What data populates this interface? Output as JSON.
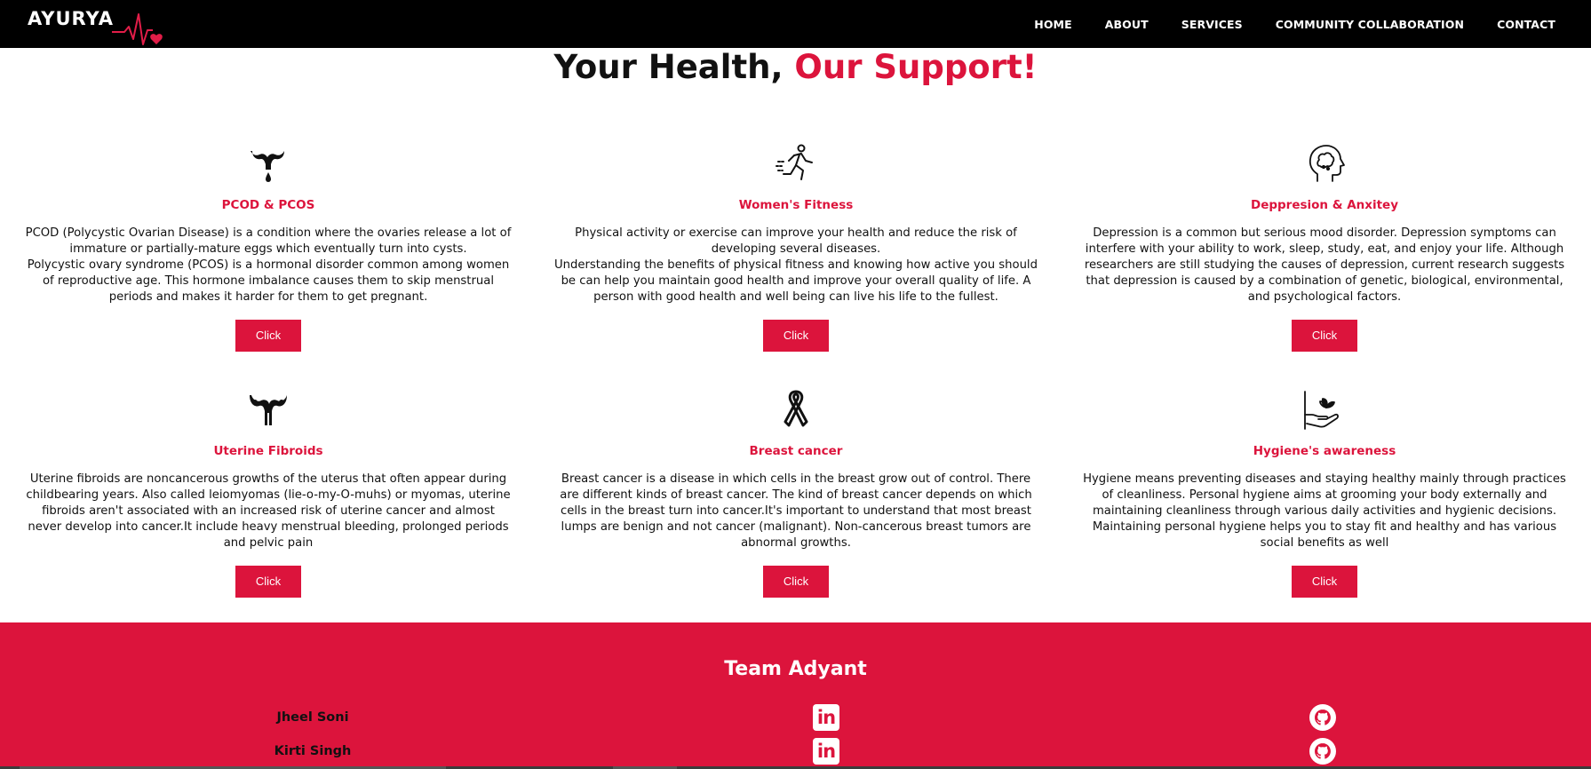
{
  "nav": {
    "brand": "AYURYA",
    "links": [
      "HOME",
      "ABOUT",
      "SERVICES",
      "COMMUNITY COLLABORATION",
      "CONTACT"
    ]
  },
  "hero": {
    "title_part1": "Your Health, ",
    "title_part2": "Our Support!"
  },
  "cards": [
    {
      "icon": "uterus-drop-icon",
      "title": "PCOD & PCOS",
      "desc": [
        "PCOD (Polycystic Ovarian Disease) is a condition where the ovaries release a lot of immature or partially-mature eggs which eventually turn into cysts.",
        "Polycystic ovary syndrome (PCOS) is a hormonal disorder common among women of reproductive age. This hormone imbalance causes them to skip menstrual periods and makes it harder for them to get pregnant."
      ],
      "button": "Click"
    },
    {
      "icon": "running-person-icon",
      "title": "Women's Fitness",
      "desc": [
        "Physical activity or exercise can improve your health and reduce the risk of developing several diseases.",
        "Understanding the benefits of physical fitness and knowing how active you should be can help you maintain good health and improve your overall quality of life. A person with good health and well being can live his life to the fullest."
      ],
      "button": "Click"
    },
    {
      "icon": "head-brain-icon",
      "title": "Deppresion & Anxitey",
      "desc": [
        "Depression is a common but serious mood disorder. Depression symptoms can interfere with your ability to work, sleep, study, eat, and enjoy your life. Although researchers are still studying the causes of depression, current research suggests that depression is caused by a combination of genetic, biological, environmental, and psychological factors."
      ],
      "button": "Click"
    },
    {
      "icon": "uterus-icon",
      "title": "Uterine Fibroids",
      "desc": [
        "Uterine fibroids are noncancerous growths of the uterus that often appear during childbearing years. Also called leiomyomas (lie-o-my-O-muhs) or myomas, uterine fibroids aren't associated with an increased risk of uterine cancer and almost never develop into cancer.It include heavy menstrual bleeding, prolonged periods and pelvic pain"
      ],
      "button": "Click"
    },
    {
      "icon": "awareness-ribbon-icon",
      "title": "Breast cancer",
      "desc": [
        "Breast cancer is a disease in which cells in the breast grow out of control. There are different kinds of breast cancer. The kind of breast cancer depends on which cells in the breast turn into cancer.It's important to understand that most breast lumps are benign and not cancer (malignant). Non-cancerous breast tumors are abnormal growths."
      ],
      "button": "Click"
    },
    {
      "icon": "hand-lotus-icon",
      "title": "Hygiene's awareness",
      "desc": [
        "Hygiene means preventing diseases and staying healthy mainly through practices of cleanliness. Personal hygiene aims at grooming your body externally and maintaining cleanliness through various daily activities and hygienic decisions. Maintaining personal hygiene helps you to stay fit and healthy and has various social benefits as well"
      ],
      "button": "Click"
    }
  ],
  "footer": {
    "title": "Team Adyant",
    "members": [
      {
        "name": "Jheel Soni",
        "linkedin": "in"
      },
      {
        "name": "Kirti Singh",
        "linkedin": "in"
      }
    ]
  },
  "colors": {
    "accent": "#dc143c",
    "nav_bg": "#000000"
  }
}
